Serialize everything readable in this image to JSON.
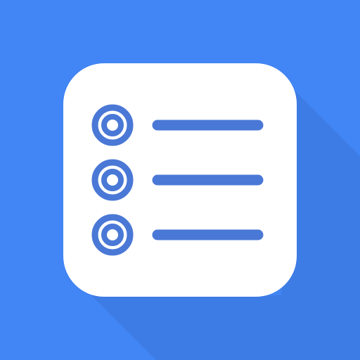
{
  "icon": {
    "name": "checklist-app-icon",
    "background_color": "#4285F4",
    "shadow_color": "#3B74D9",
    "card_color": "#FFFFFF",
    "glyph_color": "#4A78D6",
    "rows": [
      {
        "bullet_icon": "radio-ring-icon",
        "line_icon": "list-line-icon"
      },
      {
        "bullet_icon": "radio-ring-icon",
        "line_icon": "list-line-icon"
      },
      {
        "bullet_icon": "radio-ring-icon",
        "line_icon": "list-line-icon"
      }
    ]
  }
}
